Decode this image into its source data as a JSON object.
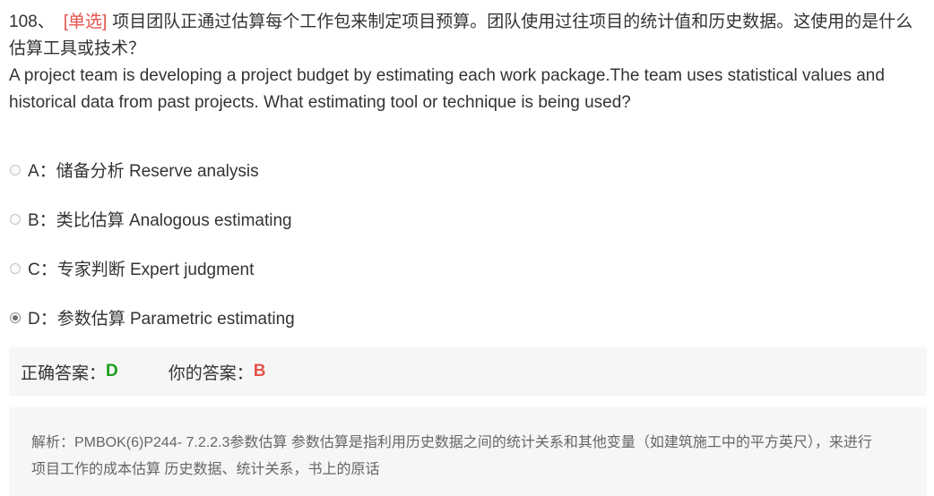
{
  "question": {
    "number": "108、",
    "type": "[单选]",
    "text_cn": "项目团队正通过估算每个工作包来制定项目预算。团队使用过往项目的统计值和历史数据。这使用的是什么估算工具或技术？",
    "text_en": "A project team is developing a project budget by estimating each work package.The team uses statistical values and historical data from past projects. What estimating tool or technique is being used?"
  },
  "options": [
    {
      "label": "A：储备分析 Reserve analysis",
      "checked": false
    },
    {
      "label": "B：类比估算 Analogous estimating",
      "checked": false
    },
    {
      "label": "C：专家判断 Expert judgment",
      "checked": false
    },
    {
      "label": "D：参数估算 Parametric estimating",
      "checked": true
    }
  ],
  "answer": {
    "correct_label": "正确答案：",
    "correct_value": "D",
    "yours_label": "你的答案：",
    "yours_value": "B"
  },
  "analysis": {
    "text": "解析：PMBOK(6)P244- 7.2.2.3参数估算 参数估算是指利用历史数据之间的统计关系和其他变量（如建筑施工中的平方英尺），来进行项目工作的成本估算 历史数据、统计关系，书上的原话"
  },
  "colors": {
    "accent_red": "#e5534b",
    "correct_green": "#1a9e1a",
    "panel_bg": "#f6f6f6"
  }
}
